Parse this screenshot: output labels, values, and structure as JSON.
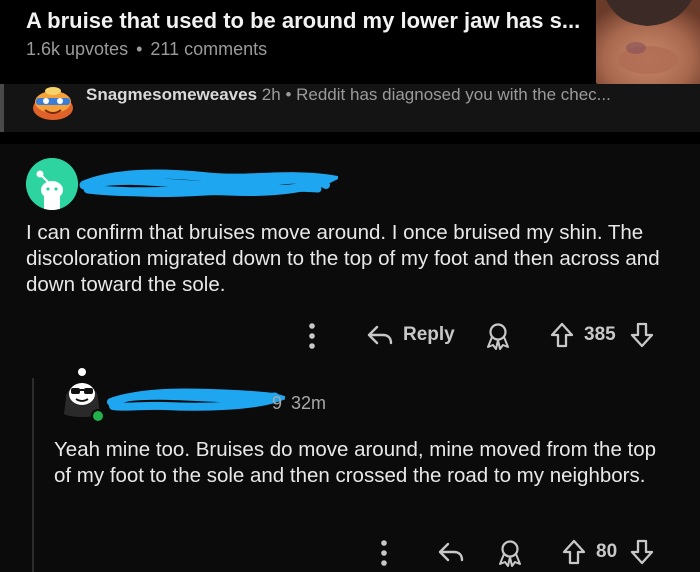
{
  "post": {
    "title": "A bruise that used to be around my lower jaw has s...",
    "upvotes": "1.6k upvotes",
    "separator": "•",
    "comments": "211 comments",
    "thumbnail_icon": "post-thumbnail-image"
  },
  "parent_comment": {
    "username": "Snagmesomeweaves",
    "age": "2h",
    "separator": "•",
    "snippet": "Reddit has diagnosed you with the chec..."
  },
  "comment": {
    "username_redacted": true,
    "body": "I can confirm that bruises move around. I once bruised my shin. The discoloration migrated down to the top of my foot and then across and down toward the sole.",
    "reply_label": "Reply",
    "score": "385",
    "accent_color": "#2dd4a0"
  },
  "reply": {
    "username_fragment": "9",
    "age": "32m",
    "body": "Yeah mine too. Bruises do move around, mine moved from the top of my foot to the sole and then crossed the road to my neighbors.",
    "score": "80",
    "online_color": "#22b14c"
  },
  "redaction_color": "#1fa6f0"
}
